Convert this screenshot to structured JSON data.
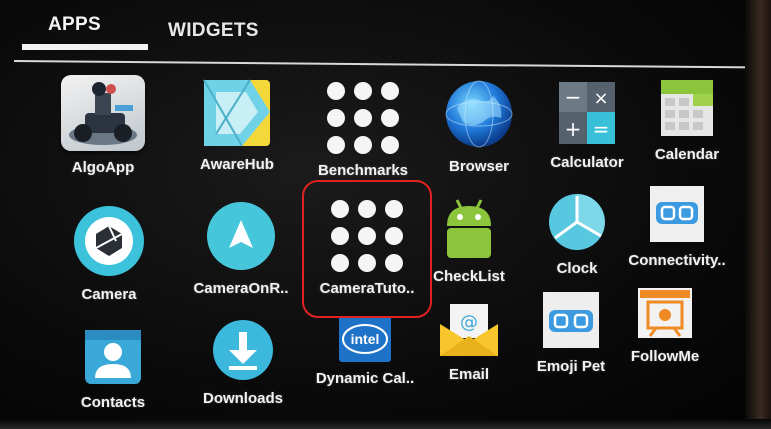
{
  "tabs": {
    "apps": "APPS",
    "widgets": "WIDGETS"
  },
  "apps": {
    "algoapp": "AlgoApp",
    "awarehub": "AwareHub",
    "benchmarks": "Benchmarks",
    "browser": "Browser",
    "calculator": "Calculator",
    "calendar": "Calendar",
    "camera": "Camera",
    "cameraonr": "CameraOnR..",
    "cameratuto": "CameraTuto..",
    "checklist": "CheckList",
    "clock": "Clock",
    "connectivity": "Connectivity..",
    "contacts": "Contacts",
    "downloads": "Downloads",
    "dynamiccal": "Dynamic Cal..",
    "email": "Email",
    "emojipet": "Emoji Pet",
    "followme": "FollowMe"
  },
  "icon_text": {
    "intel": "intel",
    "email_at": "@"
  },
  "colors": {
    "highlight": "#e02222",
    "accent_teal": "#3dc4d8",
    "android_green": "#8cc43c"
  }
}
